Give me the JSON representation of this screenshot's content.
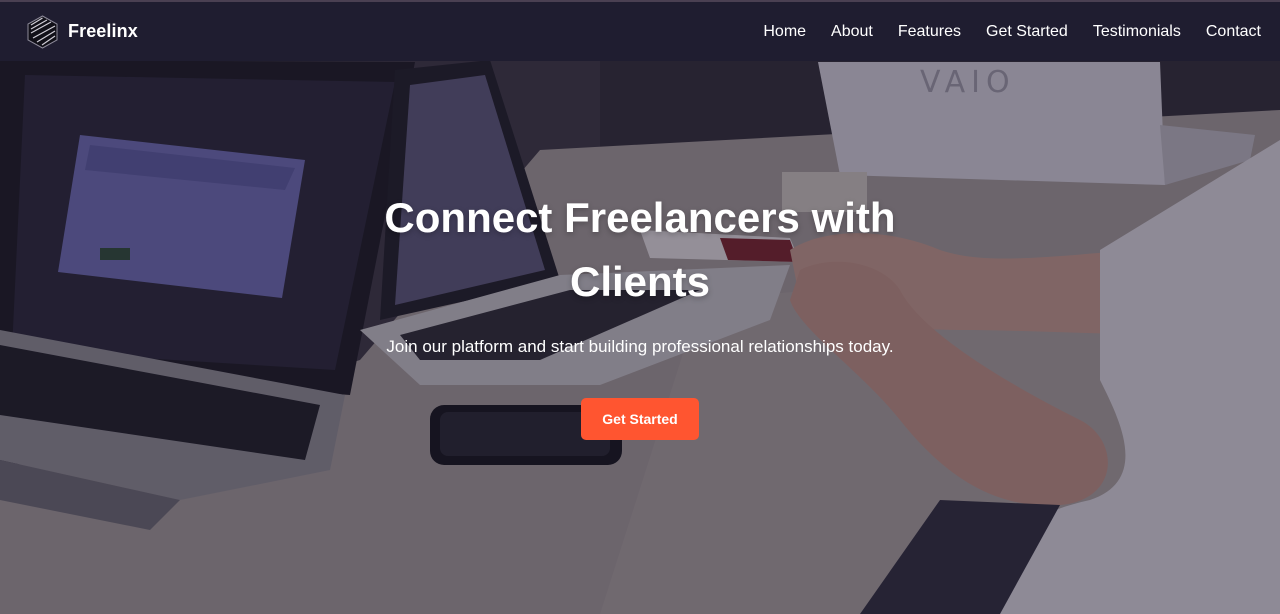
{
  "navbar": {
    "brand_name": "Freelinx",
    "links": [
      {
        "label": "Home"
      },
      {
        "label": "About"
      },
      {
        "label": "Features"
      },
      {
        "label": "Get Started"
      },
      {
        "label": "Testimonials"
      },
      {
        "label": "Contact"
      }
    ]
  },
  "hero": {
    "title": "Connect Freelancers with Clients",
    "subtitle": "Join our platform and start building professional relationships today.",
    "cta_label": "Get Started"
  },
  "icons": {
    "brand_logo": "hexagon-cube-logo-icon"
  },
  "colors": {
    "navbar_bg": "#1f1d30",
    "cta_bg": "#ff5530",
    "text": "#ffffff"
  }
}
